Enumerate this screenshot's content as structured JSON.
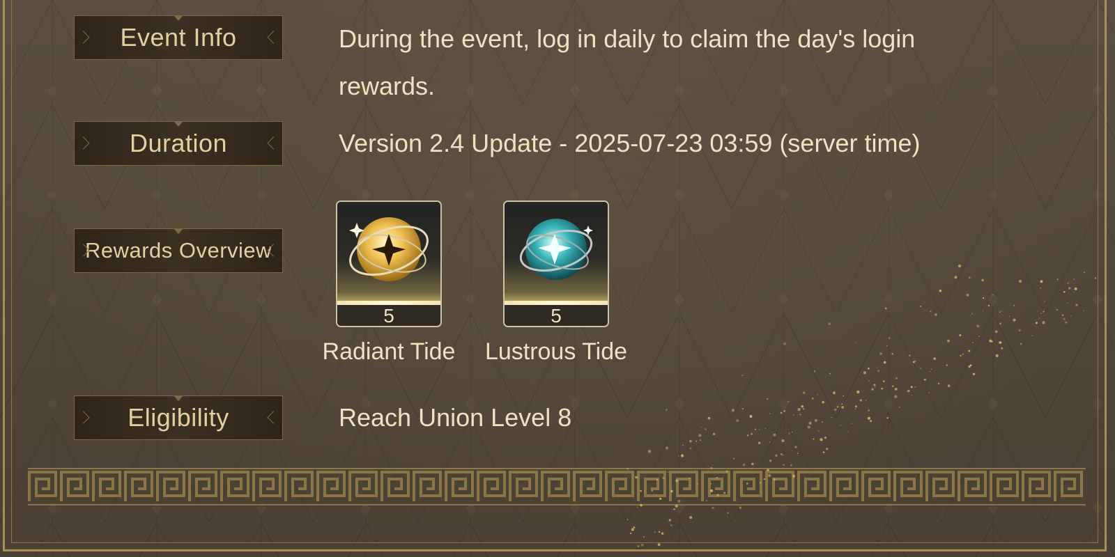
{
  "event_info": {
    "label": "Event Info",
    "text_line1": "During the event, log in daily to claim the day's login",
    "text_line2": "rewards."
  },
  "duration": {
    "label": "Duration",
    "text": "Version 2.4 Update - 2025-07-23 03:59 (server time)"
  },
  "rewards_overview": {
    "label": "Rewards Overview",
    "items": [
      {
        "name": "Radiant Tide",
        "count": "5",
        "icon": "radiant-tide-orb-icon",
        "color": "#e8b845"
      },
      {
        "name": "Lustrous Tide",
        "count": "5",
        "icon": "lustrous-tide-orb-icon",
        "color": "#3fb8b8"
      }
    ]
  },
  "eligibility": {
    "label": "Eligibility",
    "text": "Reach Union Level 8"
  },
  "colors": {
    "background": "#524839",
    "frame_gold": "#a88e5c",
    "label_bg": "#33291c",
    "label_text": "#e2cfa4",
    "value_text": "#efe2c4"
  }
}
